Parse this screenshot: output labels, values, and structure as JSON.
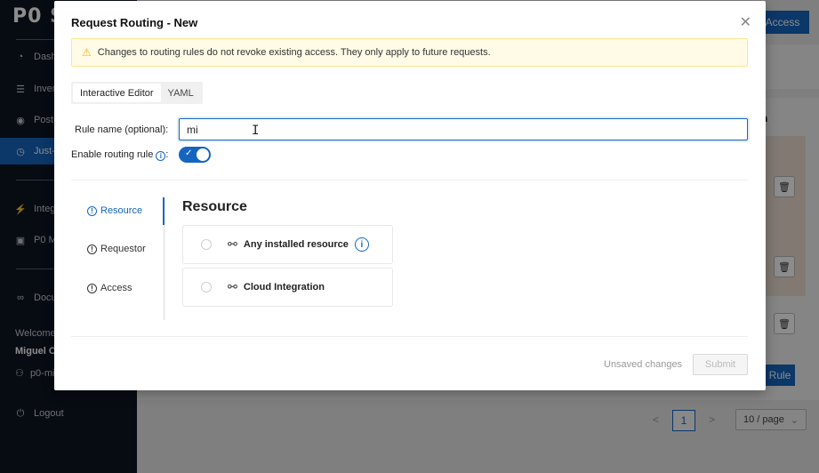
{
  "app": {
    "logo": "P0 S",
    "sidebar": {
      "items": [
        {
          "label": "Dash",
          "icon": "dashboard-icon"
        },
        {
          "label": "Inven",
          "icon": "inventory-icon"
        },
        {
          "label": "Postu",
          "icon": "eye-icon"
        },
        {
          "label": "Just-",
          "icon": "clock-icon",
          "active": true
        },
        {
          "label": "Integ",
          "icon": "plug-icon"
        },
        {
          "label": "P0 M",
          "icon": "lock-icon"
        },
        {
          "label": "Docu",
          "icon": "link-icon"
        }
      ],
      "welcome": "Welcome",
      "user_name": "Miguel C",
      "org": "p0-mi",
      "logout": "Logout"
    },
    "main": {
      "access_button": "Access",
      "column_header": "n",
      "rule_button": "Rule",
      "pagination": {
        "prev": "<",
        "current": "1",
        "next": ">",
        "page_size": "10 / page"
      }
    }
  },
  "modal": {
    "title": "Request Routing - New",
    "warning": "Changes to routing rules do not revoke existing access. They only apply to future requests.",
    "tabs": [
      "Interactive Editor",
      "YAML"
    ],
    "rule_name_label": "Rule name (optional):",
    "rule_name_value": "mi",
    "enable_label": "Enable routing rule",
    "enabled": true,
    "steps": [
      "Resource",
      "Requestor",
      "Access"
    ],
    "section_title": "Resource",
    "options": [
      {
        "label": "Any installed resource",
        "icon": "plug-icon",
        "has_info": true
      },
      {
        "label": "Cloud Integration",
        "icon": "plug-icon",
        "has_info": false
      }
    ],
    "unsaved": "Unsaved changes",
    "submit": "Submit"
  },
  "colors": {
    "accent": "#1565c0",
    "sidebar_bg": "#0d1522",
    "warning_bg": "#fffbe6",
    "warning_border": "#ffe58f"
  }
}
